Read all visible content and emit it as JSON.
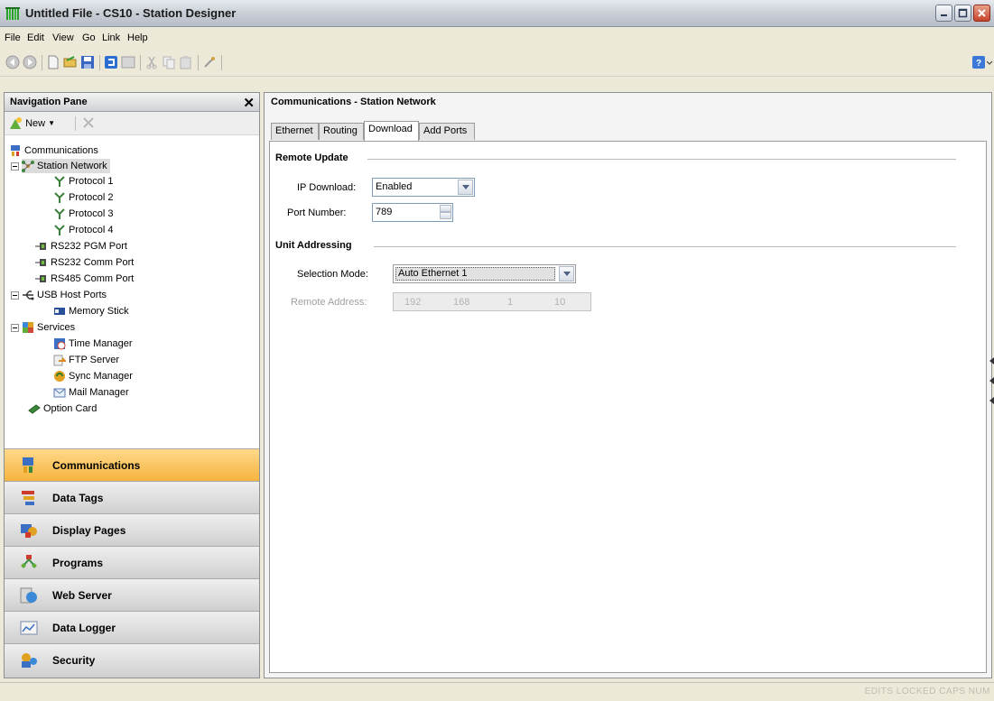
{
  "window": {
    "title": "Untitled File - CS10 - Station Designer"
  },
  "menu": [
    {
      "label": "File"
    },
    {
      "label": "Edit"
    },
    {
      "label": "View"
    },
    {
      "label": "Go"
    },
    {
      "label": "Link"
    },
    {
      "label": "Help"
    }
  ],
  "nav": {
    "title": "Navigation Pane",
    "new_label": "New",
    "tree": [
      {
        "label": "Communications",
        "icon": "communications-icon"
      },
      {
        "label": "Station Network",
        "icon": "network-icon"
      },
      {
        "label": "Protocol 1",
        "icon": "protocol-icon"
      },
      {
        "label": "Protocol 2",
        "icon": "protocol-icon"
      },
      {
        "label": "Protocol 3",
        "icon": "protocol-icon"
      },
      {
        "label": "Protocol 4",
        "icon": "protocol-icon"
      },
      {
        "label": "RS232 PGM Port",
        "icon": "serial-port-icon"
      },
      {
        "label": "RS232 Comm Port",
        "icon": "serial-port-icon"
      },
      {
        "label": "RS485 Comm Port",
        "icon": "serial-port-icon"
      },
      {
        "label": "USB Host Ports",
        "icon": "usb-icon"
      },
      {
        "label": "Memory Stick",
        "icon": "memory-stick-icon"
      },
      {
        "label": "Services",
        "icon": "services-icon"
      },
      {
        "label": "Time Manager",
        "icon": "clock-icon"
      },
      {
        "label": "FTP Server",
        "icon": "ftp-icon"
      },
      {
        "label": "Sync Manager",
        "icon": "sync-icon"
      },
      {
        "label": "Mail Manager",
        "icon": "mail-icon"
      },
      {
        "label": "Option Card",
        "icon": "option-card-icon"
      }
    ],
    "buttons": [
      {
        "label": "Communications",
        "icon": "communications-icon"
      },
      {
        "label": "Data Tags",
        "icon": "data-tags-icon"
      },
      {
        "label": "Display Pages",
        "icon": "display-pages-icon"
      },
      {
        "label": "Programs",
        "icon": "programs-icon"
      },
      {
        "label": "Web Server",
        "icon": "web-server-icon"
      },
      {
        "label": "Data Logger",
        "icon": "data-logger-icon"
      },
      {
        "label": "Security",
        "icon": "security-icon"
      }
    ]
  },
  "content": {
    "title": "Communications - Station Network",
    "tabs": [
      {
        "label": "Ethernet"
      },
      {
        "label": "Routing"
      },
      {
        "label": "Download"
      },
      {
        "label": "Add Ports"
      }
    ],
    "active_tab": "Download",
    "remote_update": {
      "title": "Remote Update",
      "ip_download_label": "IP Download:",
      "ip_download_value": "Enabled",
      "port_label": "Port Number:",
      "port_value": "789"
    },
    "unit_addressing": {
      "title": "Unit Addressing",
      "selection_label": "Selection Mode:",
      "selection_value": "Auto Ethernet 1",
      "remote_label": "Remote Address:",
      "remote_octets": [
        "192",
        "168",
        "1",
        "10"
      ]
    }
  },
  "status": {
    "text": "EDITS  LOCKED  CAPS  NUM"
  },
  "colors": {
    "active_nav": "#f6b43e",
    "accent": "#4d6185"
  }
}
